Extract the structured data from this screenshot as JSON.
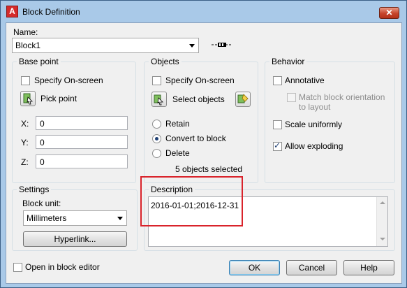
{
  "window": {
    "title": "Block Definition",
    "close_glyph": "✕"
  },
  "name_section": {
    "label": "Name:",
    "value": "Block1"
  },
  "base_point": {
    "title": "Base point",
    "specify_on_screen": "Specify On-screen",
    "pick_point": "Pick point",
    "x_label": "X:",
    "x_value": "0",
    "y_label": "Y:",
    "y_value": "0",
    "z_label": "Z:",
    "z_value": "0"
  },
  "objects": {
    "title": "Objects",
    "specify_on_screen": "Specify On-screen",
    "select_objects": "Select objects",
    "retain": "Retain",
    "convert_to_block": "Convert to block",
    "delete": "Delete",
    "selected_count": "5 objects selected",
    "selected_radio": "convert_to_block"
  },
  "behavior": {
    "title": "Behavior",
    "annotative": "Annotative",
    "match_orientation": "Match block orientation to layout",
    "scale_uniformly": "Scale uniformly",
    "allow_exploding": "Allow exploding",
    "allow_exploding_checked": true
  },
  "settings": {
    "title": "Settings",
    "block_unit_label": "Block unit:",
    "block_unit_value": "Millimeters",
    "hyperlink": "Hyperlink..."
  },
  "description": {
    "title": "Description",
    "value": "2016-01-01;2016-12-31"
  },
  "footer": {
    "open_in_editor": "Open in block editor",
    "ok": "OK",
    "cancel": "Cancel",
    "help": "Help"
  },
  "colors": {
    "titlebar": "#a9c9e8",
    "dialog_bg": "#f0f0f0",
    "highlight_box": "#d9232b",
    "close_button": "#c7442a"
  }
}
